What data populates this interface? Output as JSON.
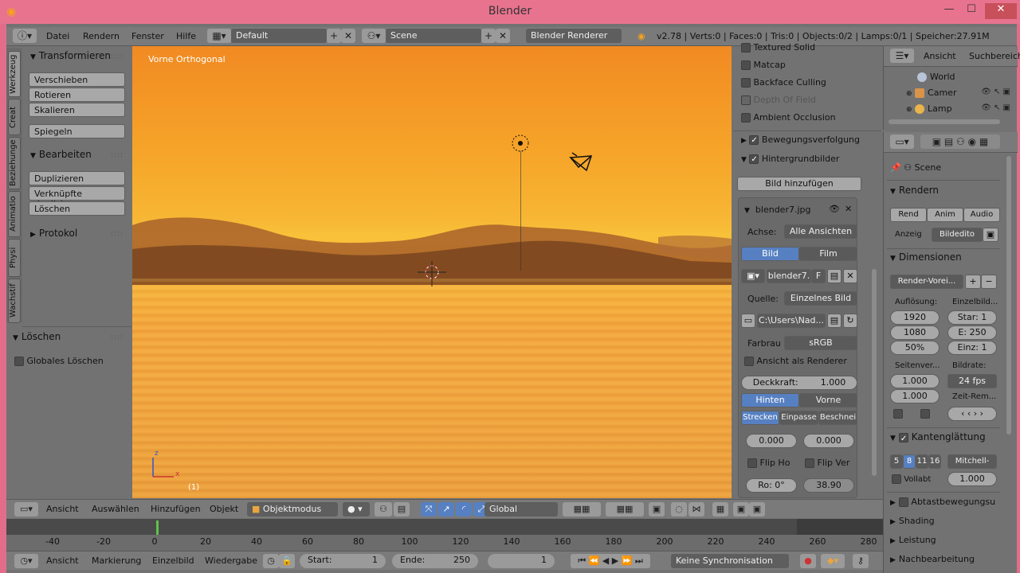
{
  "window": {
    "title": "Blender",
    "minimize": "—",
    "maximize": "☐",
    "close": "✕"
  },
  "topbar": {
    "menus": [
      "Datei",
      "Rendern",
      "Fenster",
      "Hilfe"
    ],
    "layout": "Default",
    "scene": "Scene",
    "renderer": "Blender Renderer",
    "stats": "v2.78 | Verts:0 | Faces:0 | Tris:0 | Objects:0/2 | Lamps:0/1 | Speicher:27.91M"
  },
  "tool_tabs": [
    "Werkzeug",
    "Creat",
    "Beziehunge",
    "Animatio",
    "Physi",
    "Wachstif"
  ],
  "tool_shelf": {
    "transform_header": "Transformieren",
    "transform_buttons": [
      "Verschieben",
      "Rotieren",
      "Skalieren"
    ],
    "mirror_button": "Spiegeln",
    "edit_header": "Bearbeiten",
    "edit_buttons": [
      "Duplizieren",
      "Verknüpfte duplizieren",
      "Löschen"
    ],
    "history_header": "Protokol",
    "delete_header": "Löschen",
    "global_delete": "Globales Löschen"
  },
  "viewport": {
    "view_name": "Vorne Orthogonal",
    "frame_label": "(1)",
    "axis_z": "z",
    "axis_x": "x"
  },
  "n_panel": {
    "shading_items": [
      "Textured Solid",
      "Matcap",
      "Backface Culling",
      "Depth Of Field",
      "Ambient Occlusion"
    ],
    "motion_tracking": "Bewegungsverfolgung",
    "background_images": "Hintergrundbilder",
    "add_image": "Bild hinzufügen",
    "image_name": "blender7.jpg",
    "axis_label": "Achse:",
    "axis_value": "Alle Ansichten",
    "tab_image": "Bild",
    "tab_film": "Film",
    "image_field": "blender7.",
    "image_field_f": "F",
    "source_label": "Quelle:",
    "source_value": "Einzelnes Bild",
    "path": "C:\\Users\\Nad...",
    "colorspace_label": "Farbrau",
    "colorspace_value": "sRGB",
    "view_as_render": "Ansicht als Renderer",
    "opacity_label": "Deckkraft:",
    "opacity_value": "1.000",
    "back": "Hinten",
    "front": "Vorne",
    "stretch": "Strecken",
    "fit": "Einpasse",
    "crop": "Beschnei",
    "offset_x": "0.000",
    "offset_y": "0.000",
    "flip_h": "Flip Ho",
    "flip_v": "Flip Ver",
    "rotation": "Ro: 0°",
    "size": "38.90"
  },
  "outliner": {
    "menu_view": "Ansicht",
    "menu_search": "Suchbereich",
    "items": [
      "World",
      "Camer",
      "Lamp"
    ]
  },
  "properties": {
    "scene_label": "Scene",
    "render_header": "Rendern",
    "render_buttons": [
      "Rend",
      "Anim",
      "Audio"
    ],
    "display_label": "Anzeig",
    "display_value": "Bildedito",
    "dimensions_header": "Dimensionen",
    "preset": "Render-Vorei...",
    "resolution_label": "Auflösung:",
    "res_x": "1920",
    "res_y": "1080",
    "res_pct": "50%",
    "frame_range_label": "Einzelbild...",
    "start": "Star: 1",
    "end": "E: 250",
    "step": "Einz: 1",
    "aspect_label": "Seitenver...",
    "aspect_x": "1.000",
    "aspect_y": "1.000",
    "framerate_label": "Bildrate:",
    "framerate": "24 fps",
    "time_remap": "Zeit-Rem...",
    "aa_header": "Kantenglättung",
    "aa_samples": [
      "5",
      "8",
      "11",
      "16"
    ],
    "aa_filter": "Mitchell-",
    "full_sample": "Vollabt",
    "full_sample_value": "1.000",
    "sampled_motion": "Abtastbewegungsu",
    "shading": "Shading",
    "performance": "Leistung",
    "post_processing": "Nachbearbeitung"
  },
  "view_header": {
    "menus": [
      "Ansicht",
      "Auswählen",
      "Hinzufügen",
      "Objekt"
    ],
    "mode": "Objektmodus",
    "orientation": "Global"
  },
  "timeline": {
    "ticks": [
      "-40",
      "-20",
      "0",
      "20",
      "40",
      "60",
      "80",
      "100",
      "120",
      "140",
      "160",
      "180",
      "200",
      "220",
      "240",
      "260",
      "280"
    ]
  },
  "timeline_header": {
    "menus": [
      "Ansicht",
      "Markierung",
      "Einzelbild",
      "Wiedergabe"
    ],
    "start_label": "Start:",
    "start_value": "1",
    "end_label": "Ende:",
    "end_value": "250",
    "current": "1",
    "sync": "Keine Synchronisation"
  },
  "colors": {
    "accent_blue": "#5680c2",
    "title_pink": "#e8738f",
    "panel_gray": "#727272"
  }
}
